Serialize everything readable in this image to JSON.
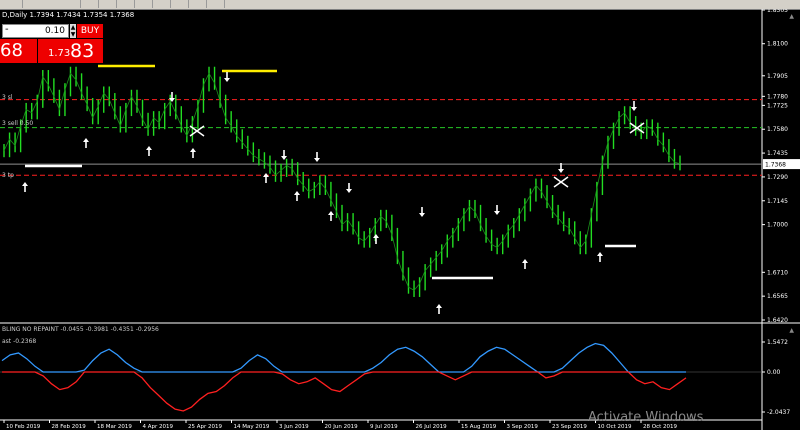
{
  "symbol_info": "D,Daily  1.7394 1.7434 1.7354 1.7368",
  "trade_panel": {
    "lot_minus": "-",
    "lot_value": "0.10",
    "buy_label": "BUY",
    "sell_price": "68",
    "buy_price_small": "1.73",
    "buy_price_big": "83"
  },
  "levels": [
    {
      "label": "3 sl",
      "price": 1.776,
      "color": "#ff2020"
    },
    {
      "label": "3 sell 0.50",
      "price": 1.759,
      "color": "#26c826"
    },
    {
      "label": "3 tp",
      "price": 1.73,
      "color": "#ff2020"
    }
  ],
  "price_axis": {
    "ticks": [
      "1.8305",
      "1.8100",
      "1.7905",
      "1.7780",
      "1.7725",
      "1.7580",
      "1.7435",
      "1.7290",
      "1.7145",
      "1.7000",
      "1.6710",
      "1.6565",
      "1.6420"
    ],
    "current_price": "1.7368",
    "current_price_value": 1.7368
  },
  "indicator": {
    "label": "BLING NO REPAINT  -0.0455 -0.3981 -0.4351 -0.2956",
    "subtitle": "ast -0.2368",
    "ticks": [
      "1.5472",
      "0.00",
      "-2.0437"
    ]
  },
  "time_axis": {
    "labels": [
      "10 Feb 2019",
      "28 Feb 2019",
      "18 Mar 2019",
      "4 Apr 2019",
      "25 Apr 2019",
      "14 May 2019",
      "3 Jun 2019",
      "20 Jun 2019",
      "9 Jul 2019",
      "26 Jul 2019",
      "15 Aug 2019",
      "3 Sep 2019",
      "23 Sep 2019",
      "10 Oct 2019",
      "28 Oct 2019"
    ]
  },
  "watermark": "Activate Windows",
  "chart_data": {
    "type": "line",
    "title": "",
    "ylim": [
      1.642,
      1.8305
    ],
    "series": [
      {
        "values": [
          1.745,
          1.752,
          1.748,
          1.76,
          1.77,
          1.768,
          1.775,
          1.79,
          1.785,
          1.778,
          1.77,
          1.782,
          1.792,
          1.788,
          1.78,
          1.773,
          1.765,
          1.772,
          1.78,
          1.776,
          1.768,
          1.76,
          1.77,
          1.778,
          1.772,
          1.764,
          1.758,
          1.765,
          1.762,
          1.77,
          1.775,
          1.768,
          1.76,
          1.754,
          1.762,
          1.772,
          1.785,
          1.792,
          1.786,
          1.775,
          1.765,
          1.76,
          1.754,
          1.75,
          1.746,
          1.742,
          1.74,
          1.738,
          1.735,
          1.73,
          1.733,
          1.736,
          1.734,
          1.728,
          1.724,
          1.72,
          1.722,
          1.726,
          1.722,
          1.715,
          1.708,
          1.7,
          1.703,
          1.698,
          1.692,
          1.69,
          1.694,
          1.7,
          1.705,
          1.702,
          1.694,
          1.68,
          1.67,
          1.662,
          1.66,
          1.664,
          1.672,
          1.676,
          1.68,
          1.684,
          1.69,
          1.694,
          1.7,
          1.706,
          1.711,
          1.708,
          1.7,
          1.693,
          1.688,
          1.686,
          1.69,
          1.696,
          1.7,
          1.706,
          1.712,
          1.718,
          1.724,
          1.72,
          1.714,
          1.708,
          1.704,
          1.7,
          1.698,
          1.692,
          1.686,
          1.69,
          1.706,
          1.722,
          1.738,
          1.75,
          1.758,
          1.765,
          1.768,
          1.762,
          1.758,
          1.756,
          1.76,
          1.758,
          1.752,
          1.748,
          1.742,
          1.738,
          1.737
        ]
      }
    ]
  }
}
